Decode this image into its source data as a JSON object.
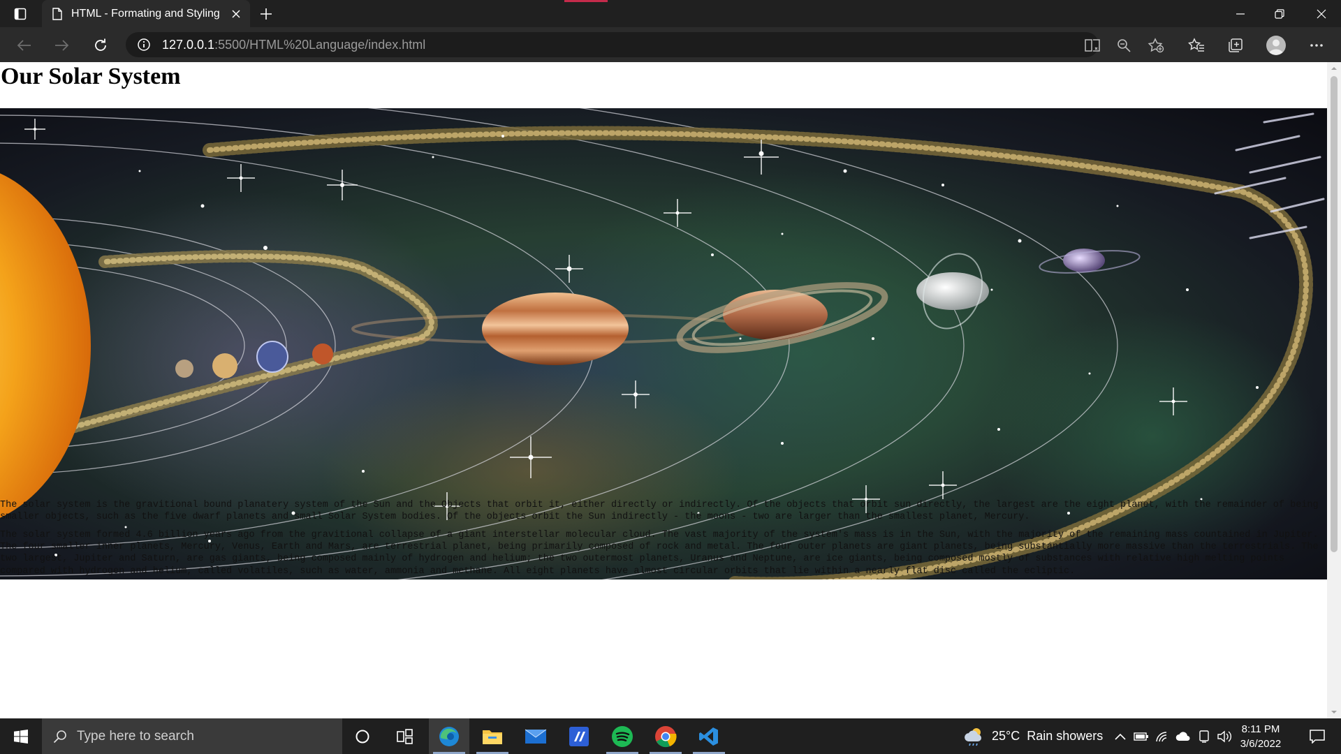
{
  "browser": {
    "tab_title": "HTML - Formating and Styling",
    "url_host": "127.0.0.1",
    "url_path": ":5500/HTML%20Language/index.html",
    "icons": [
      "tab-actions-icon",
      "page-icon",
      "close-icon",
      "plus-icon",
      "minimize-icon",
      "restore-icon",
      "close-window-icon",
      "back-icon",
      "forward-icon",
      "refresh-icon",
      "info-icon",
      "immersive-reader-icon",
      "zoom-icon",
      "add-favorite-icon",
      "favorites-icon",
      "collections-icon",
      "profile-icon",
      "more-icon"
    ]
  },
  "page": {
    "heading": "Our Solar System",
    "paragraph_1": "The solar system is the gravitional bound planatery system of the Sun and the Objects that orbit it, either directly or indirectly. Of the objects that orbit sun directly, the largest are the eight planet, with the remainder of being smaller objects, such as the five dwarf planets and small Solar System bodies. Of the objects orbit the Sun indirectly - the moons - two are larger than the smallest planet, Mercury.",
    "paragraph_2": "The solar system formed 4.6 billion years ago from the gravitional collapse of a giant interstellar molecular cloud. The vast majority of the system's mass is in the Sun, with the majority of the remaining mass countained in Jupiter. The four smaller inner planets, Mercury, Venus, Earth and Mars, are terrestrial planet, being primarily composed of rock and metal. The four outer planets are giant planets, being substantially more massive than the terrestrials. The two largest, Jupiter and Saturn, are gas giants, being composed mainly of hydrogen and helium; the two outermost planets, Uranus and Neptune, are ice giants, being composed mostly of substances with relative high melting points compared with hydrogen and helium, called volatiles, such as water, ammonia and methane. All eight planets have almost circular orbits that lie within a nearly flat disc called the ecliptic."
  },
  "taskbar": {
    "search_placeholder": "Type here to search",
    "apps": [
      "cortana-icon",
      "task-view-icon",
      "edge-icon",
      "file-explorer-icon",
      "mail-icon",
      "visual-studio-icon",
      "spotify-icon",
      "chrome-icon",
      "vscode-icon"
    ],
    "weather_temp": "25°C",
    "weather_desc": "Rain showers",
    "time": "8:11 PM",
    "date": "3/6/2022"
  },
  "colors": {
    "accent_tab_media": "#c42b4b",
    "spotify": "#1db954",
    "vscode": "#2b8fe0"
  }
}
